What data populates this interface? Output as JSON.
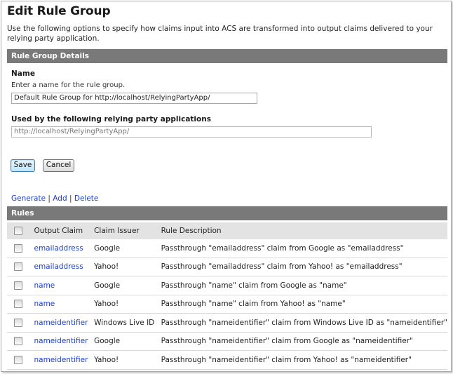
{
  "page": {
    "title": "Edit Rule Group",
    "description": "Use the following options to specify how claims input into ACS are transformed into output claims delivered to your relying party application."
  },
  "details": {
    "section_title": "Rule Group Details",
    "name_label": "Name",
    "name_hint": "Enter a name for the rule group.",
    "name_value": "Default Rule Group for http://localhost/RelyingPartyApp/",
    "used_by_label": "Used by the following relying party applications",
    "used_by_value": "http://localhost/RelyingPartyApp/"
  },
  "buttons": {
    "save": "Save",
    "cancel": "Cancel"
  },
  "actions": {
    "generate": "Generate",
    "add": "Add",
    "delete": "Delete",
    "separator": "|"
  },
  "rules": {
    "section_title": "Rules",
    "headers": {
      "output_claim": "Output Claim",
      "claim_issuer": "Claim Issuer",
      "rule_description": "Rule Description"
    },
    "rows": [
      {
        "claim": "emailaddress",
        "issuer": "Google",
        "description": "Passthrough \"emailaddress\" claim from Google as \"emailaddress\""
      },
      {
        "claim": "emailaddress",
        "issuer": "Yahoo!",
        "description": "Passthrough \"emailaddress\" claim from Yahoo! as \"emailaddress\""
      },
      {
        "claim": "name",
        "issuer": "Google",
        "description": "Passthrough \"name\" claim from Google as \"name\""
      },
      {
        "claim": "name",
        "issuer": "Yahoo!",
        "description": "Passthrough \"name\" claim from Yahoo! as \"name\""
      },
      {
        "claim": "nameidentifier",
        "issuer": "Windows Live ID",
        "description": "Passthrough \"nameidentifier\" claim from Windows Live ID as \"nameidentifier\""
      },
      {
        "claim": "nameidentifier",
        "issuer": "Google",
        "description": "Passthrough \"nameidentifier\" claim from Google as \"nameidentifier\""
      },
      {
        "claim": "nameidentifier",
        "issuer": "Yahoo!",
        "description": "Passthrough \"nameidentifier\" claim from Yahoo! as \"nameidentifier\""
      }
    ]
  },
  "colors": {
    "section_bar": "#797979",
    "table_header": "#e3e3e3",
    "link": "#1a3ed4"
  }
}
